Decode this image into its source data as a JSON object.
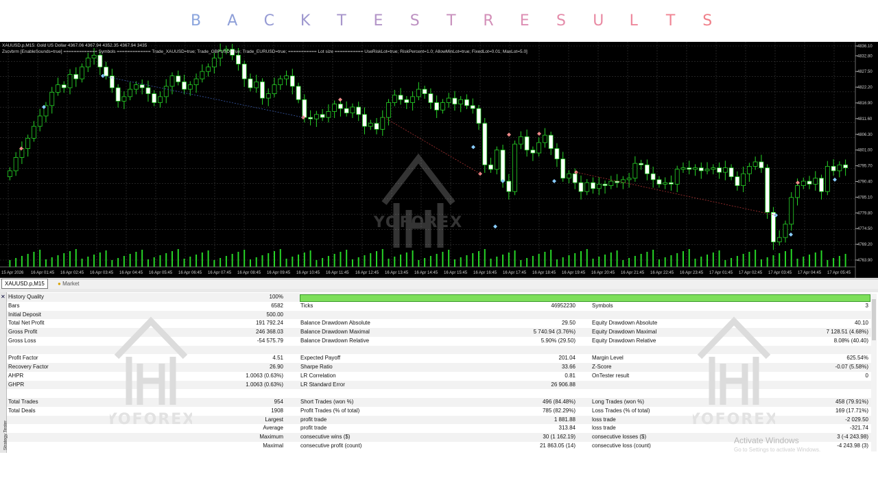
{
  "banner": {
    "letters": [
      "B",
      "A",
      "C",
      "K",
      "T",
      "E",
      "S",
      "T",
      "R",
      "E",
      "S",
      "U",
      "L",
      "T",
      "S"
    ],
    "colors": [
      "#8aa4dd",
      "#8e9fd8",
      "#969bd4",
      "#9e98cf",
      "#a795cb",
      "#b293c7",
      "#bd91c2",
      "#c890bd",
      "#d38fb8",
      "#dd8eb3",
      "#e48caa",
      "#e98aa3",
      "#ee879b",
      "#f08493",
      "#f0808a"
    ]
  },
  "chart": {
    "header_line1": "XAUUSD.p,M15:  Gold US Dollar  4367.06 4367.94 4352.35 4367.94  3435",
    "header_line2": "Zscvbrm [EnableSounds=true] ============= Symbols ============= Trade_XAUUSD=true; Trade_GBPUSD=true; Trade_EURUSD=true; =========== Lot size =========== UseRiskLot=true; RiskPercent=1.0; AllowMinLot=true; FixedLot=0.01; MaxLot=5.0]",
    "price_labels": [
      "4836.10",
      "4832.80",
      "4827.50",
      "4822.20",
      "4816.90",
      "4811.60",
      "4806.30",
      "4801.00",
      "4795.70",
      "4790.40",
      "4785.10",
      "4779.80",
      "4774.50",
      "4769.20",
      "4763.90"
    ],
    "time_labels": [
      "15 Apr 2026",
      "16 Apr 01:45",
      "16 Apr 02:45",
      "16 Apr 03:45",
      "16 Apr 04:45",
      "16 Apr 05:45",
      "16 Apr 06:45",
      "16 Apr 07:45",
      "16 Apr 08:45",
      "16 Apr 09:45",
      "16 Apr 10:45",
      "16 Apr 11:45",
      "16 Apr 12:45",
      "16 Apr 13:45",
      "16 Apr 14:45",
      "16 Apr 15:45",
      "16 Apr 16:45",
      "16 Apr 17:45",
      "16 Apr 18:45",
      "16 Apr 19:45",
      "16 Apr 20:45",
      "16 Apr 21:45",
      "16 Apr 22:45",
      "16 Apr 23:45",
      "17 Apr 01:45",
      "17 Apr 02:45",
      "17 Apr 03:45",
      "17 Apr 04:45",
      "17 Apr 05:45"
    ],
    "watermark": "YOFOREX",
    "closes": [
      4794.0,
      4798.5,
      4801.5,
      4805.0,
      4809.0,
      4812.5,
      4816.0,
      4820.5,
      4823.0,
      4822.0,
      4826.5,
      4825.0,
      4829.0,
      4832.0,
      4833.0,
      4829.0,
      4826.0,
      4822.0,
      4817.5,
      4819.0,
      4821.5,
      4823.0,
      4822.0,
      4820.0,
      4817.0,
      4819.0,
      4822.5,
      4826.0,
      4824.0,
      4821.5,
      4823.0,
      4825.0,
      4827.5,
      4829.0,
      4832.0,
      4834.5,
      4835.0,
      4833.0,
      4830.0,
      4825.0,
      4822.0,
      4824.0,
      4818.5,
      4820.0,
      4823.0,
      4825.0,
      4826.0,
      4822.5,
      4818.0,
      4812.0,
      4811.5,
      4813.0,
      4812.0,
      4814.0,
      4816.5,
      4815.0,
      4813.5,
      4815.5,
      4813.0,
      4809.0,
      4810.0,
      4808.0,
      4812.0,
      4817.0,
      4819.5,
      4818.0,
      4817.0,
      4819.0,
      4821.5,
      4820.0,
      4817.0,
      4814.5,
      4817.0,
      4818.5,
      4816.5,
      4818.0,
      4816.0,
      4815.0,
      4810.0,
      4796.0,
      4794.5,
      4801.0,
      4790.5,
      4787.0,
      4803.0,
      4805.5,
      4801.0,
      4800.0,
      4803.5,
      4806.0,
      4801.5,
      4798.0,
      4791.5,
      4793.0,
      4790.0,
      4787.0,
      4790.0,
      4788.0,
      4789.5,
      4789.0,
      4790.5,
      4790.0,
      4791.0,
      4791.5,
      4796.5,
      4796.0,
      4793.0,
      4791.0,
      4789.5,
      4790.0,
      4789.5,
      4794.5,
      4795.0,
      4794.5,
      4795.0,
      4794.0,
      4794.5,
      4795.0,
      4793.5,
      4795.0,
      4792.0,
      4789.0,
      4793.0,
      4795.5,
      4797.0,
      4795.0,
      4780.0,
      4770.0,
      4771.5,
      4776.0,
      4785.0,
      4789.0,
      4790.5,
      4789.5,
      4791.5,
      4787.0,
      4795.5,
      4794.0,
      4796.0,
      4795.0
    ]
  },
  "tabs": {
    "tab1": "XAUUSD.p,M15",
    "tab2": "Market"
  },
  "report": {
    "side_label": "Strategy Tester",
    "history_quality_label": "History Quality",
    "history_quality_value": "100%",
    "rows": [
      [
        "Bars",
        "6582",
        "Ticks",
        "46952230",
        "Symbols",
        "3"
      ],
      [
        "Initial Deposit",
        "500.00",
        "",
        "",
        "",
        ""
      ],
      [
        "Total Net Profit",
        "191 792.24",
        "Balance Drawdown Absolute",
        "29.50",
        "Equity Drawdown Absolute",
        "40.10"
      ],
      [
        "Gross Profit",
        "246 368.03",
        "Balance Drawdown Maximal",
        "5 740.94 (3.76%)",
        "Equity Drawdown Maximal",
        "7 128.51 (4.68%)"
      ],
      [
        "Gross Loss",
        "-54 575.79",
        "Balance Drawdown Relative",
        "5.90% (29.50)",
        "Equity Drawdown Relative",
        "8.08% (40.40)"
      ],
      [
        "",
        "",
        "",
        "",
        "",
        ""
      ],
      [
        "Profit Factor",
        "4.51",
        "Expected Payoff",
        "201.04",
        "Margin Level",
        "625.54%"
      ],
      [
        "Recovery Factor",
        "26.90",
        "Sharpe Ratio",
        "33.66",
        "Z-Score",
        "-0.07 (5.58%)"
      ],
      [
        "AHPR",
        "1.0063 (0.63%)",
        "LR Correlation",
        "0.81",
        "OnTester result",
        "0"
      ],
      [
        "GHPR",
        "1.0063 (0.63%)",
        "LR Standard Error",
        "26 906.88",
        "",
        ""
      ],
      [
        "",
        "",
        "",
        "",
        "",
        ""
      ],
      [
        "Total Trades",
        "954",
        "Short Trades (won %)",
        "496 (84.48%)",
        "Long Trades (won %)",
        "458 (79.91%)"
      ],
      [
        "Total Deals",
        "1908",
        "Profit Trades (% of total)",
        "785 (82.29%)",
        "Loss Trades (% of total)",
        "169 (17.71%)"
      ],
      [
        "",
        "Largest",
        "profit trade",
        "1 881.88",
        "loss trade",
        "-2 029.50"
      ],
      [
        "",
        "Average",
        "profit trade",
        "313.84",
        "loss trade",
        "-321.74"
      ],
      [
        "",
        "Maximum",
        "consecutive wins ($)",
        "30 (1 162.19)",
        "consecutive losses ($)",
        "3 (-4 243.98)"
      ],
      [
        "",
        "Maximal",
        "consecutive profit (count)",
        "21 863.05 (14)",
        "consecutive loss (count)",
        "-4 243.98 (3)"
      ]
    ],
    "watermark": "YOFOREX",
    "activate_title": "Activate Windows",
    "activate_sub": "Go to Settings to activate Windows."
  }
}
